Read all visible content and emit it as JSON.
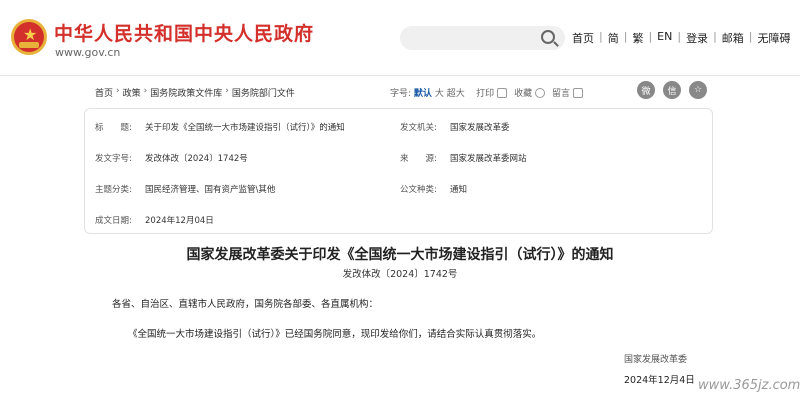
{
  "header": {
    "site_title": "中华人民共和国中央人民政府",
    "site_url": "www.gov.cn",
    "search_placeholder": "",
    "nav": [
      "首页",
      "简",
      "繁",
      "EN",
      "登录",
      "邮箱",
      "无障碍"
    ]
  },
  "breadcrumb": [
    "首页",
    "政策",
    "国务院政策文件库",
    "国务院部门文件"
  ],
  "tools": {
    "font_label": "字号:",
    "font_default": "默认",
    "font_large": "大",
    "font_xlarge": "超大",
    "print": "打印",
    "favorite": "收藏",
    "comment": "留言"
  },
  "info": {
    "title_key": "标　　题:",
    "title_val": "关于印发《全国统一大市场建设指引（试行）》的通知",
    "issuer_key": "发文机关:",
    "issuer_val": "国家发展改革委",
    "docno_key": "发文字号:",
    "docno_val": "发改体改〔2024〕1742号",
    "source_key": "来　　源:",
    "source_val": "国家发展改革委网站",
    "topic_key": "主题分类:",
    "topic_val": "国民经济管理、国有资产监管\\其他",
    "type_key": "公文种类:",
    "type_val": "通知",
    "date_key": "成文日期:",
    "date_val": "2024年12月04日"
  },
  "document": {
    "title": "国家发展改革委关于印发《全国统一大市场建设指引（试行）》的通知",
    "doc_no": "发改体改〔2024〕1742号",
    "salutation": "各省、自治区、直辖市人民政府，国务院各部委、各直属机构：",
    "body": "《全国统一大市场建设指引（试行）》已经国务院同意，现印发给你们，请结合实际认真贯彻落实。",
    "issuer": "国家发展改革委",
    "date": "2024年12月4日"
  },
  "watermark": "www.365jz.com"
}
